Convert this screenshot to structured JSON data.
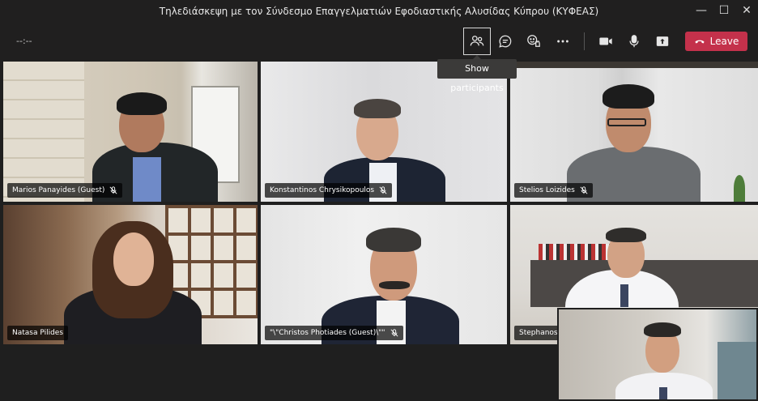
{
  "window": {
    "title": "Τηλεδιάσκεψη με τον Σύνδεσμο Επαγγελματιών Εφοδιαστικής Αλυσίδας Κύπρου (ΚΥΦΕΑΣ)",
    "minimize": "—",
    "maximize": "☐",
    "close": "✕"
  },
  "toolbar": {
    "timer": "--:--",
    "leave_label": "Leave",
    "tooltip": "Show participants",
    "accent": "#c4314b"
  },
  "participants": [
    {
      "name": "Marios Panayides (Guest)",
      "muted": true
    },
    {
      "name": "Konstantinos Chrysikopoulos",
      "muted": true
    },
    {
      "name": "Stelios Loizides",
      "muted": true
    },
    {
      "name": "Natasa Pilides",
      "muted": false
    },
    {
      "name": "\"\\\"Christos Photiades (Guest)\\\"\"",
      "muted": true
    },
    {
      "name": "Stephanos C",
      "muted": false
    }
  ]
}
